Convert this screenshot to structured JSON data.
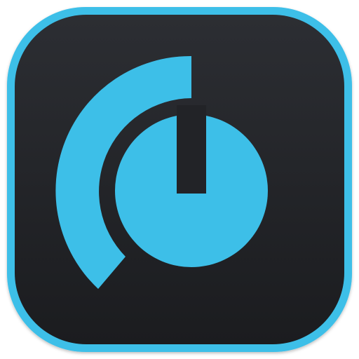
{
  "app_icon": {
    "name": "volume-knob-app-icon",
    "icon": "volume-knob-icon",
    "level": 0.35,
    "colors": {
      "border": "#3dbfe8",
      "background_top": "#2c2e33",
      "background_bottom": "#1b1c1f",
      "accent": "#3dbfe8",
      "gap": "#222327"
    }
  }
}
